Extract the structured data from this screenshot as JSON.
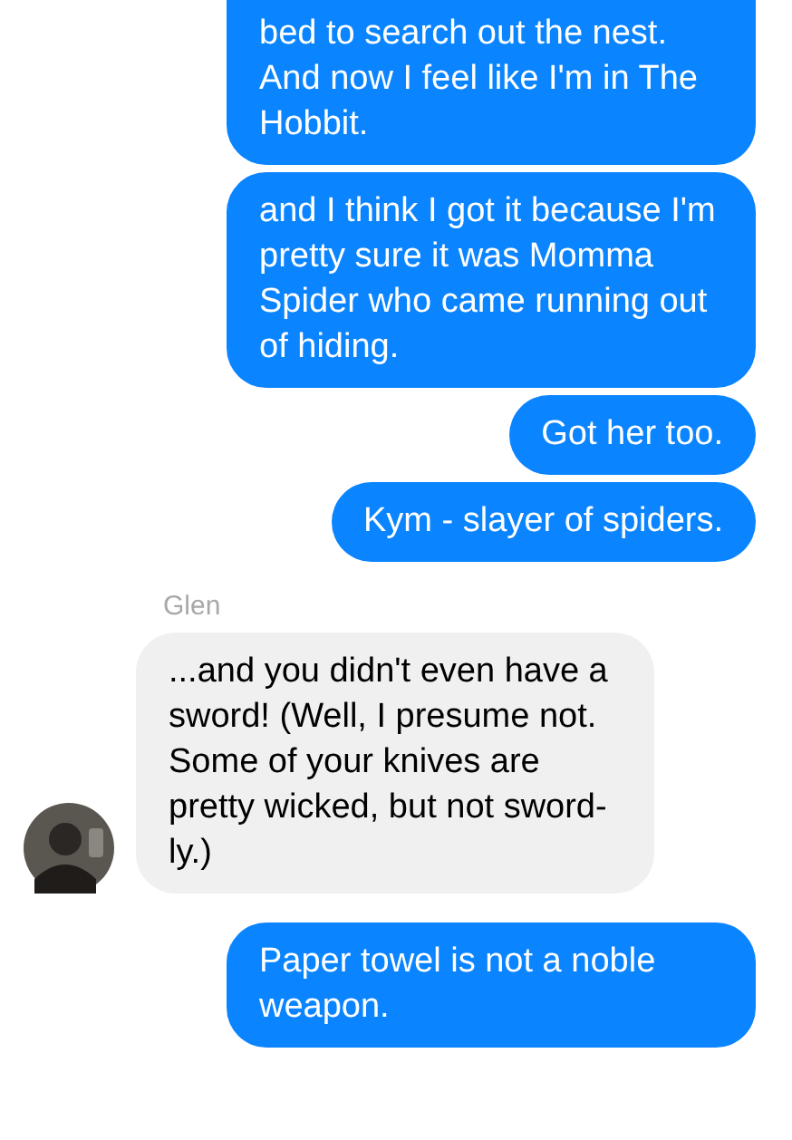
{
  "messages": [
    {
      "kind": "sent",
      "text": "bed to search out the nest. And now I feel like I'm in The Hobbit.",
      "cut_top": true
    },
    {
      "kind": "sent",
      "text": "and I think I got it because I'm pretty sure it was Momma Spider who came running out of hiding."
    },
    {
      "kind": "sent",
      "text": "Got her too."
    },
    {
      "kind": "sent",
      "text": "Kym - slayer of spiders."
    },
    {
      "kind": "received",
      "sender": "Glen",
      "text": "...and you didn't even have a sword!  (Well, I presume not.  Some of your knives are pretty wicked, but not sword-ly.)",
      "avatar": true
    },
    {
      "kind": "sent",
      "text": "Paper towel is not a noble weapon."
    }
  ]
}
